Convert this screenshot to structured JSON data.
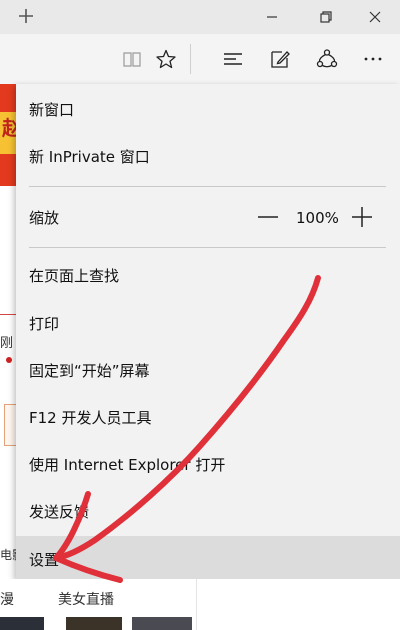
{
  "titlebar": {
    "new_tab_icon": "plus-icon",
    "minimize_icon": "minimize-icon",
    "restore_icon": "restore-icon",
    "close_icon": "close-icon"
  },
  "toolbar": {
    "icons": [
      "reading-view-icon",
      "favorite-star-icon",
      "hub-icon",
      "web-note-icon",
      "share-icon",
      "more-icon"
    ]
  },
  "menu": {
    "new_window": "新窗口",
    "new_inprivate": "新 InPrivate 窗口",
    "zoom_label": "缩放",
    "zoom_value": "100%",
    "find_on_page": "在页面上查找",
    "print": "打印",
    "pin_to_start": "固定到“开始”屏幕",
    "dev_tools": "F12 开发人员工具",
    "open_with_ie": "使用 Internet Explorer 打开",
    "send_feedback": "发送反馈",
    "settings": "设置"
  },
  "page": {
    "banner_text": "赵",
    "side_text_1": "刚",
    "side_text_2": "电影",
    "bottom_tab_1": "漫",
    "bottom_tab_2": "美女直播"
  },
  "colors": {
    "menu_bg": "#f2f2f2",
    "highlight": "#dcdcdc",
    "annotation": "#e0303a"
  }
}
